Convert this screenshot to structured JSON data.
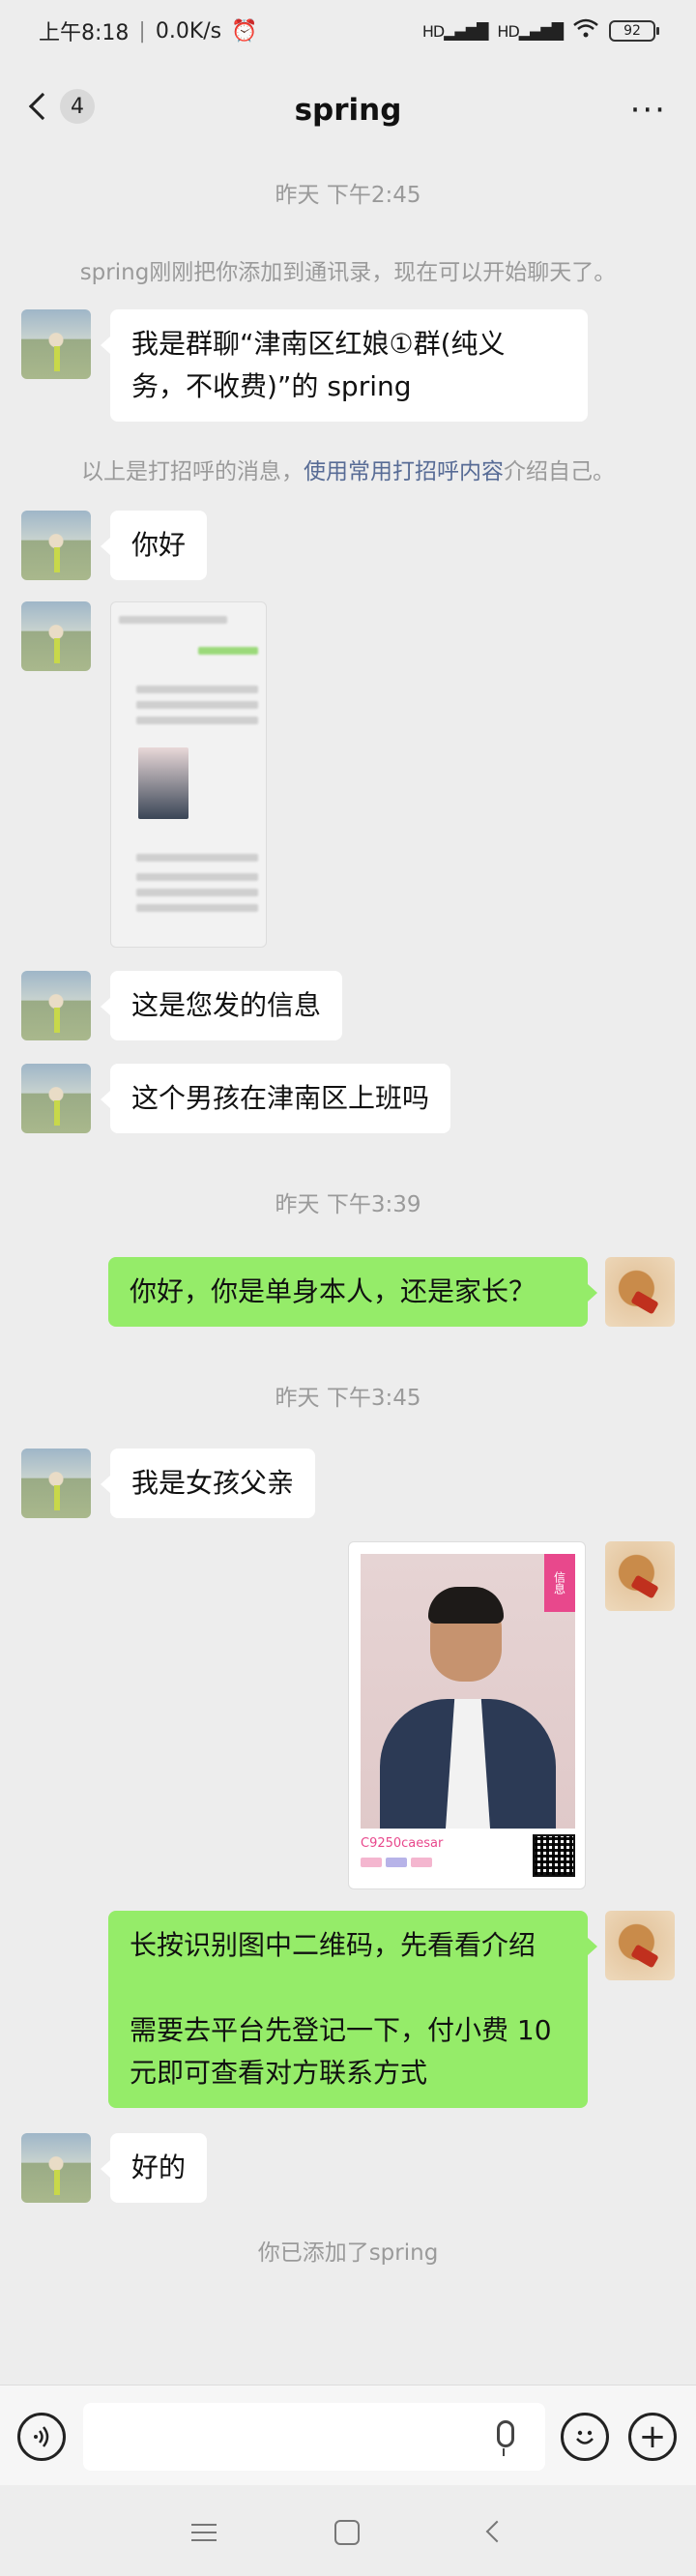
{
  "status_bar": {
    "time": "上午8:18",
    "speed": "0.0K/s",
    "signal1": "HD",
    "signal2": "HD",
    "battery": "92"
  },
  "nav": {
    "unread_count": "4",
    "title": "spring"
  },
  "timestamps": {
    "t1": "昨天 下午2:45",
    "t2": "昨天 下午3:39",
    "t3": "昨天 下午3:45"
  },
  "system_messages": {
    "added_contact": "spring刚刚把你添加到通讯录，现在可以开始聊天了。",
    "greeting_prefix": "以上是打招呼的消息，",
    "greeting_link": "使用常用打招呼内容",
    "greeting_suffix": "介绍自己。",
    "you_added": "你已添加了spring"
  },
  "messages": {
    "m1_line1": "我是群聊“津南区红娘①群(纯义",
    "m1_line2": "务，不收费)”的 spring",
    "m2": "你好",
    "m3": "这是您发的信息",
    "m4": "这个男孩在津南区上班吗",
    "m5": "你好，你是单身本人，还是家长？",
    "m6": "我是女孩父亲",
    "m7_line1": "长按识别图中二维码，先看看介绍",
    "m7_line2": "需要去平台先登记一下，付小费 10",
    "m7_line3": "元即可查看对方联系方式",
    "m8": "好的"
  },
  "profile_card": {
    "code": "C9250caesar",
    "tag": "信息"
  },
  "input": {
    "placeholder": ""
  }
}
